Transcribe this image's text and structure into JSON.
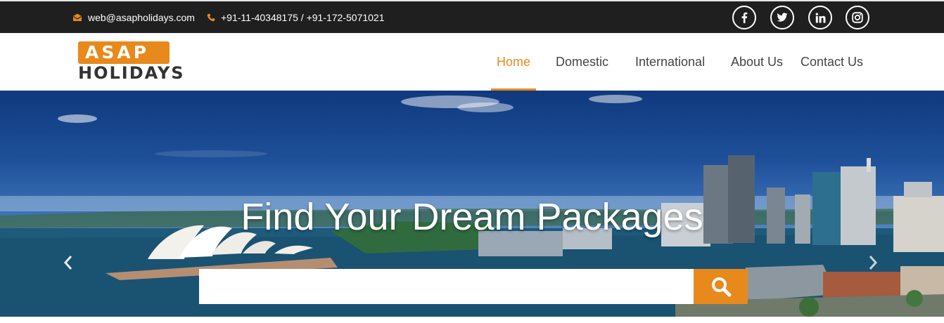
{
  "topbar": {
    "email": "web@asapholidays.com",
    "phone": "+91-11-40348175 / +91-172-5071021",
    "social": [
      {
        "icon": "facebook-icon"
      },
      {
        "icon": "twitter-icon"
      },
      {
        "icon": "linkedin-icon"
      },
      {
        "icon": "instagram-icon"
      }
    ]
  },
  "logo": {
    "top": "ASAP",
    "bottom": "HOLIDAYS"
  },
  "nav": {
    "items": [
      {
        "label": "Home",
        "active": true
      },
      {
        "label": "Domestic",
        "active": false
      },
      {
        "label": "International",
        "active": false
      },
      {
        "label": "About Us",
        "active": false
      },
      {
        "label": "Contact Us",
        "active": false
      }
    ]
  },
  "hero": {
    "title": "Find Your Dream Packages",
    "search_value": "",
    "search_placeholder": "",
    "search_icon": "search-icon",
    "prev_icon": "chevron-left-icon",
    "next_icon": "chevron-right-icon"
  },
  "colors": {
    "accent": "#e8891b",
    "topbar_bg": "#1f1f1f",
    "nav_text": "#444444"
  }
}
